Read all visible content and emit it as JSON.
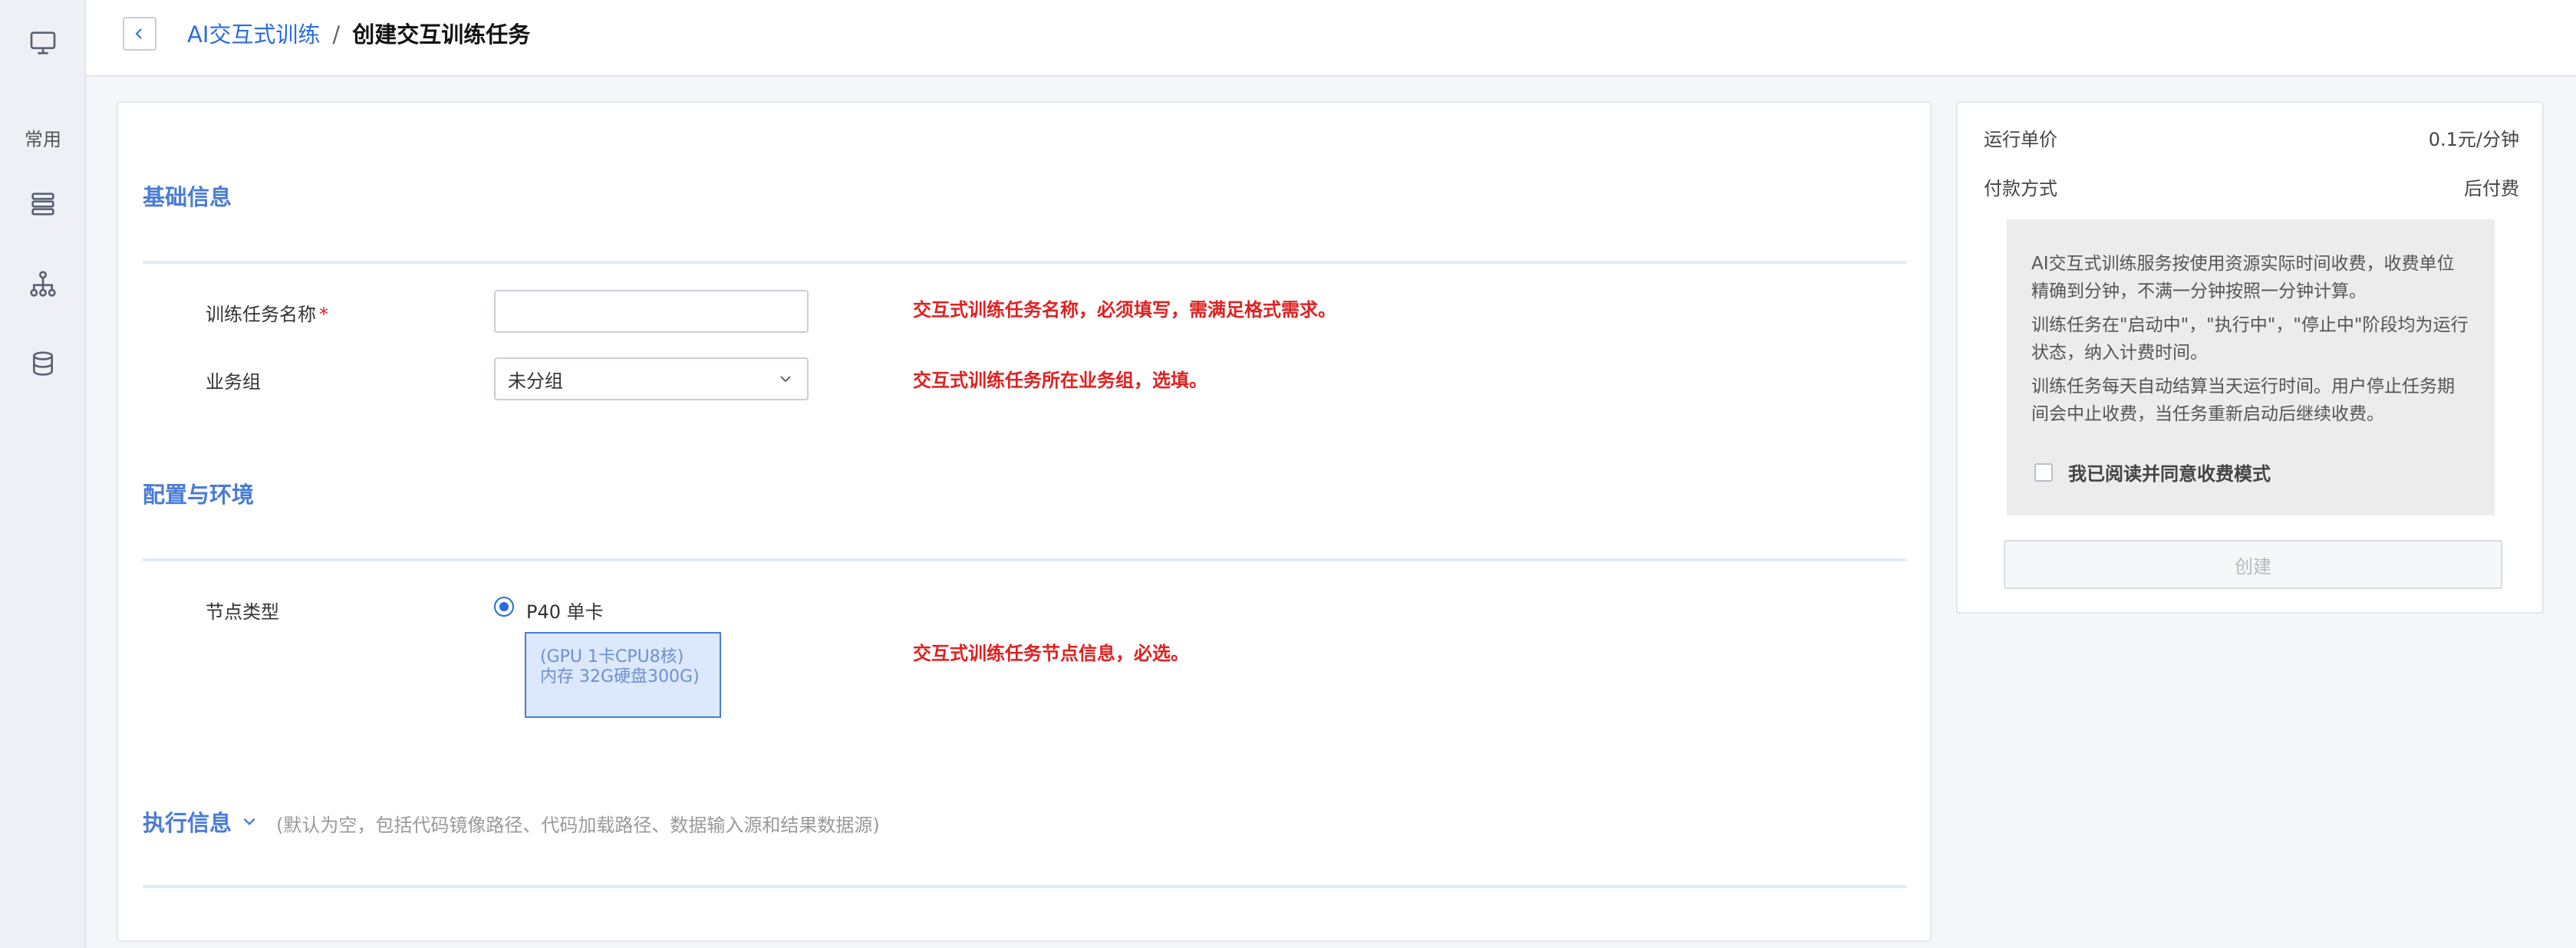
{
  "sidebar": {
    "common_label": "常用",
    "icons": [
      "monitor-icon",
      "server-stack-icon",
      "org-tree-icon",
      "database-icon"
    ]
  },
  "header": {
    "breadcrumb_parent": "AI交互式训练",
    "breadcrumb_separator": "/",
    "breadcrumb_current": "创建交互训练任务"
  },
  "form": {
    "basic_section_title": "基础信息",
    "task_name_label": "训练任务名称",
    "required_mark": "*",
    "task_name_value": "",
    "task_name_hint": "交互式训练任务名称，必须填写，需满足格式需求。",
    "group_label": "业务组",
    "group_selected": "未分组",
    "group_hint": "交互式训练任务所在业务组，选填。",
    "config_section_title": "配置与环境",
    "node_type_label": "节点类型",
    "node_option_label": "P40 单卡",
    "node_spec_line1": "(GPU 1卡CPU8核)",
    "node_spec_line2": "内存 32G硬盘300G)",
    "node_hint": "交互式训练任务节点信息，必选。",
    "exec_section_title": "执行信息",
    "exec_section_note": "(默认为空，包括代码镜像路径、代码加载路径、数据输入源和结果数据源)"
  },
  "pricing": {
    "unit_price_label": "运行单价",
    "unit_price_value": "0.1元/分钟",
    "payment_label": "付款方式",
    "payment_value": "后付费",
    "notice_p1": "AI交互式训练服务按使用资源实际时间收费，收费单位精确到分钟，不满一分钟按照一分钟计算。",
    "notice_p2": "训练任务在\"启动中\"，\"执行中\"，\"停止中\"阶段均为运行状态，纳入计费时间。",
    "notice_p3": "训练任务每天自动结算当天运行时间。用户停止任务期间会中止收费，当任务重新启动后继续收费。",
    "agree_label": "我已阅读并同意收费模式",
    "agree_checked": false,
    "create_button": "创建"
  },
  "colors": {
    "accent": "#2a6ce0",
    "section_title": "#4a7bd6",
    "hint_red": "#e02020"
  }
}
